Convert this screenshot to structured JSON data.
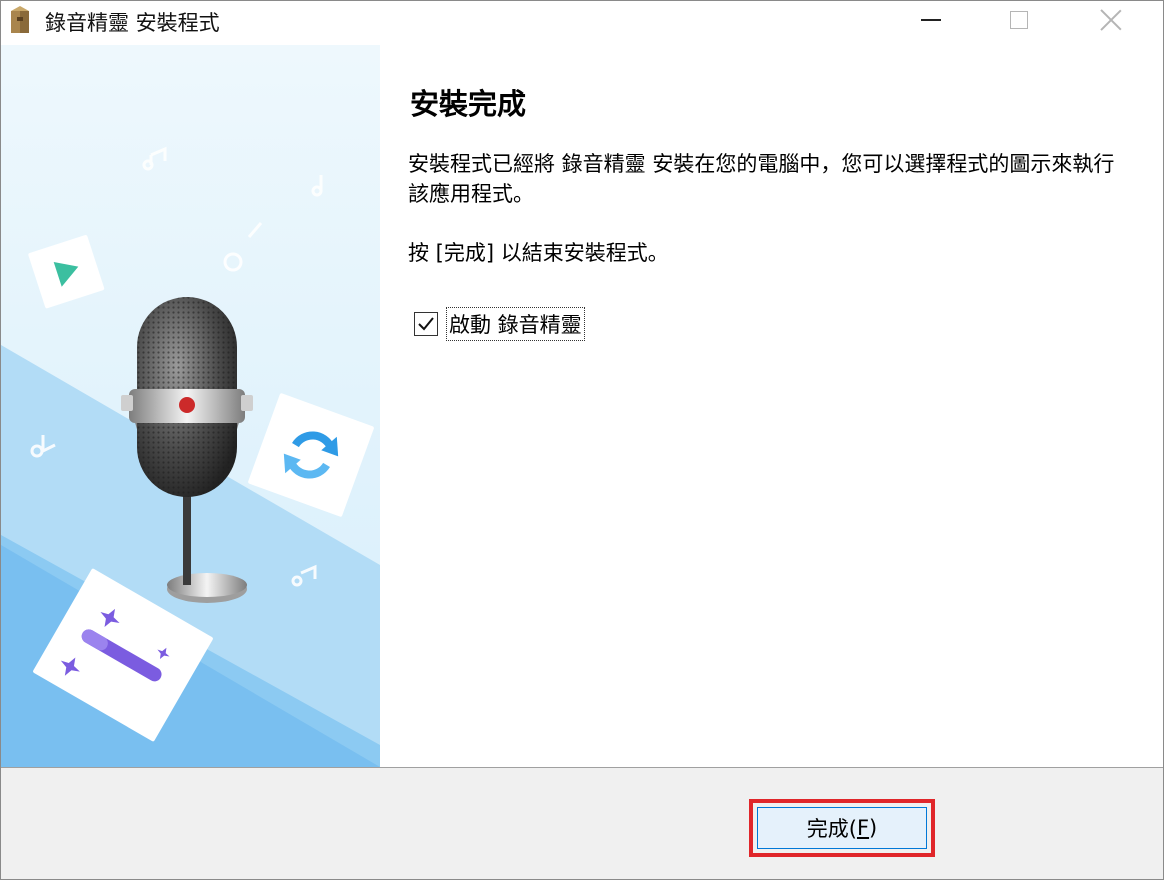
{
  "window": {
    "title": "錄音精靈 安裝程式",
    "app_icon": "installer-box-icon"
  },
  "content": {
    "heading": "安裝完成",
    "message": "安裝程式已經將 錄音精靈 安裝在您的電腦中，您可以選擇程式的圖示來執行該應用程式。",
    "instruction": "按 [完成] 以結束安裝程式。",
    "launch_checkbox": {
      "label": "啟動 錄音精靈",
      "checked": true
    }
  },
  "footer": {
    "finish_button": {
      "label_main": "完成(",
      "label_accel": "F",
      "label_end": ")"
    },
    "highlight_color": "#e0262a"
  },
  "banner": {
    "icons": [
      "microphone-icon",
      "play-icon",
      "sync-icon",
      "magic-wand-icon",
      "music-note-icon"
    ]
  }
}
